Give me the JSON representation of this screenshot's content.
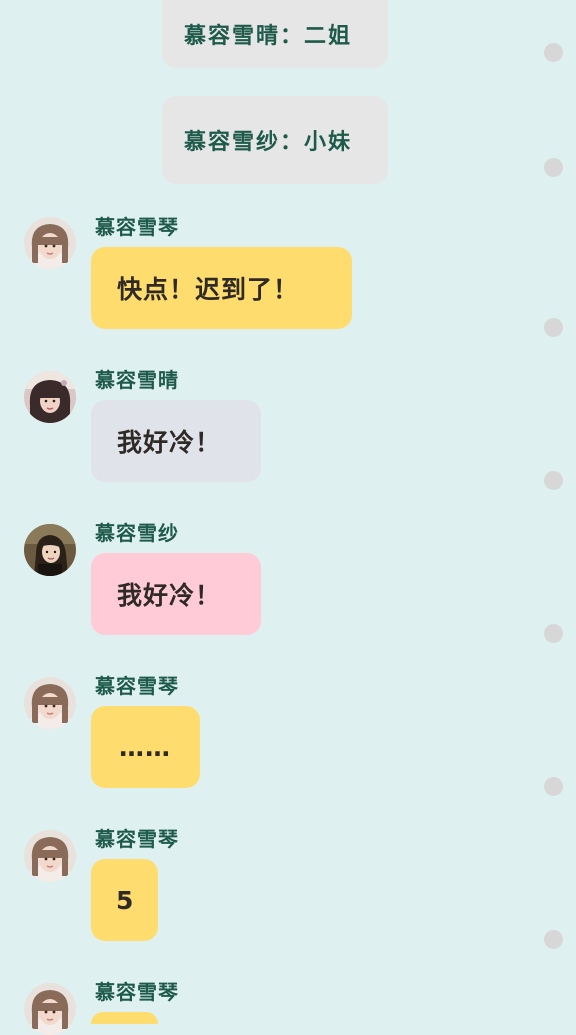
{
  "system_messages": [
    {
      "text": "慕容雪晴：二姐"
    },
    {
      "text": "慕容雪纱：小妹"
    }
  ],
  "messages": [
    {
      "sender": "慕容雪琴",
      "text": "快点！迟到了！",
      "color": "#ffdc6e"
    },
    {
      "sender": "慕容雪晴",
      "text": "我好冷！",
      "color": "#e0e4ea"
    },
    {
      "sender": "慕容雪纱",
      "text": "我好冷！",
      "color": "#ffcbd6"
    },
    {
      "sender": "慕容雪琴",
      "text": "……",
      "color": "#ffdc6e"
    },
    {
      "sender": "慕容雪琴",
      "text": "5",
      "color": "#ffdc6e"
    },
    {
      "sender": "慕容雪琴",
      "text": "",
      "color": "#ffdc6e"
    }
  ],
  "colors": {
    "background": "#dff0f0",
    "sender_name": "#1d5a4a",
    "system_bubble": "#e6e6e6",
    "dot": "#d7d7d7"
  }
}
